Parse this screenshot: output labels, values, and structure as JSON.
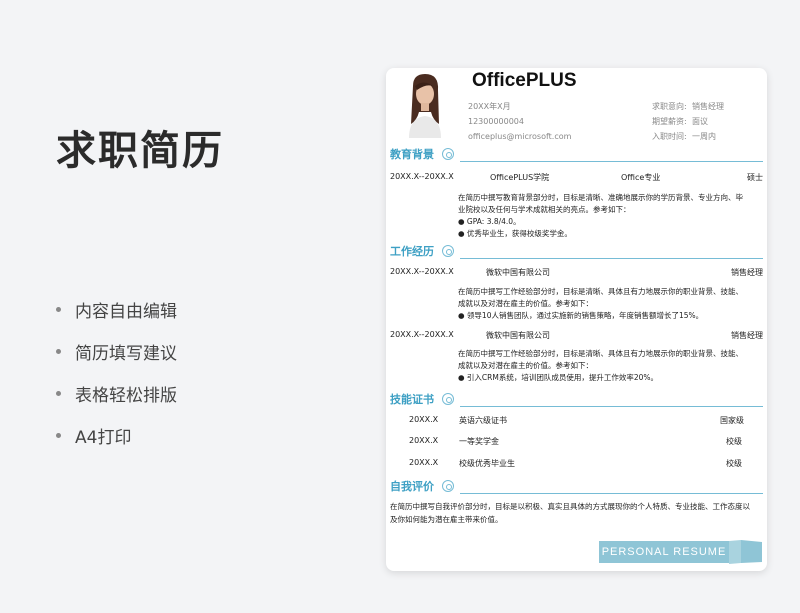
{
  "page": {
    "title": "求职简历",
    "features": [
      "内容自由编辑",
      "简历填写建议",
      "表格轻松排版",
      "A4打印"
    ]
  },
  "resume": {
    "name": "OfficePLUS",
    "info_left": [
      "20XX年X月",
      "12300000004",
      "officeplus@microsoft.com"
    ],
    "info_right": [
      {
        "label": "求职意向:",
        "value": "销售经理"
      },
      {
        "label": "期望薪资:",
        "value": "面议"
      },
      {
        "label": "入职时间:",
        "value": "一周内"
      }
    ],
    "education": {
      "title": "教育背景",
      "period": "20XX.X--20XX.X",
      "school": "OfficePLUS学院",
      "major": "Office专业",
      "degree": "硕士",
      "desc": [
        "在简历中撰写教育背景部分时，目标是清晰、准确地展示你的学历背景、专业方向、毕业院校以及任何与学术成就相关的亮点。参考如下：",
        "● GPA: 3.8/4.0。",
        "● 优秀毕业生，获得校级奖学金。"
      ]
    },
    "work": {
      "title": "工作经历",
      "jobs": [
        {
          "period": "20XX.X--20XX.X",
          "company": "微软中国有限公司",
          "position": "销售经理",
          "desc": [
            "在简历中撰写工作经验部分时，目标是清晰、具体且有力地展示你的职业背景、技能、成就以及对潜在雇主的价值。参考如下：",
            "● 领导10人销售团队，通过实施新的销售策略，年度销售额增长了15%。"
          ]
        },
        {
          "period": "20XX.X--20XX.X",
          "company": "微软中国有限公司",
          "position": "销售经理",
          "desc": [
            "在简历中撰写工作经验部分时，目标是清晰、具体且有力地展示你的职业背景、技能、成就以及对潜在雇主的价值。参考如下：",
            "● 引入CRM系统，培训团队成员使用，提升工作效率20%。"
          ]
        }
      ]
    },
    "certificates": {
      "title": "技能证书",
      "items": [
        {
          "date": "20XX.X",
          "name": "英语六级证书",
          "level": "国家级"
        },
        {
          "date": "20XX.X",
          "name": "一等奖学金",
          "level": "校级"
        },
        {
          "date": "20XX.X",
          "name": "校级优秀毕业生",
          "level": "校级"
        }
      ]
    },
    "self_eval": {
      "title": "自我评价",
      "text": "在简历中撰写自我评价部分时，目标是以积极、真实且具体的方式展现你的个人特质、专业技能、工作态度以及你如何能为潜在雇主带来价值。"
    },
    "banner": "PERSONAL  RESUME"
  },
  "colors": {
    "accent": "#3ea0c4",
    "line": "#76bcd6",
    "banner": "#8fc5d6"
  }
}
